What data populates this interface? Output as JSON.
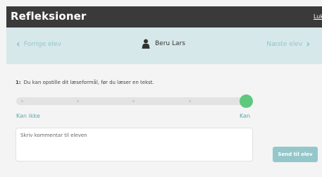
{
  "window": {
    "title": "Refleksioner",
    "close_label": "Luk"
  },
  "nav": {
    "prev_label": "Forrige elev",
    "next_label": "Næste elev",
    "student_name": "Beru Lars",
    "prev_icon": "chevron-left-icon",
    "next_icon": "chevron-right-icon",
    "student_icon": "person-icon"
  },
  "question": {
    "number": "1:",
    "text": "Du kan opstille dit læseformål, før du læser en tekst.",
    "scale": {
      "min_label": "Kan ikke",
      "max_label": "Kan",
      "steps": 5,
      "selected_step": 5
    }
  },
  "comment": {
    "placeholder": "Skriv kommentar til eleven"
  },
  "send_button": {
    "label": "Send til elev"
  },
  "colors": {
    "titlebar": "#3a3a3a",
    "navbar": "#d7e8ea",
    "accent": "#7fc4c8",
    "knob": "#5ec87c",
    "send_button": "#95c7ca"
  }
}
